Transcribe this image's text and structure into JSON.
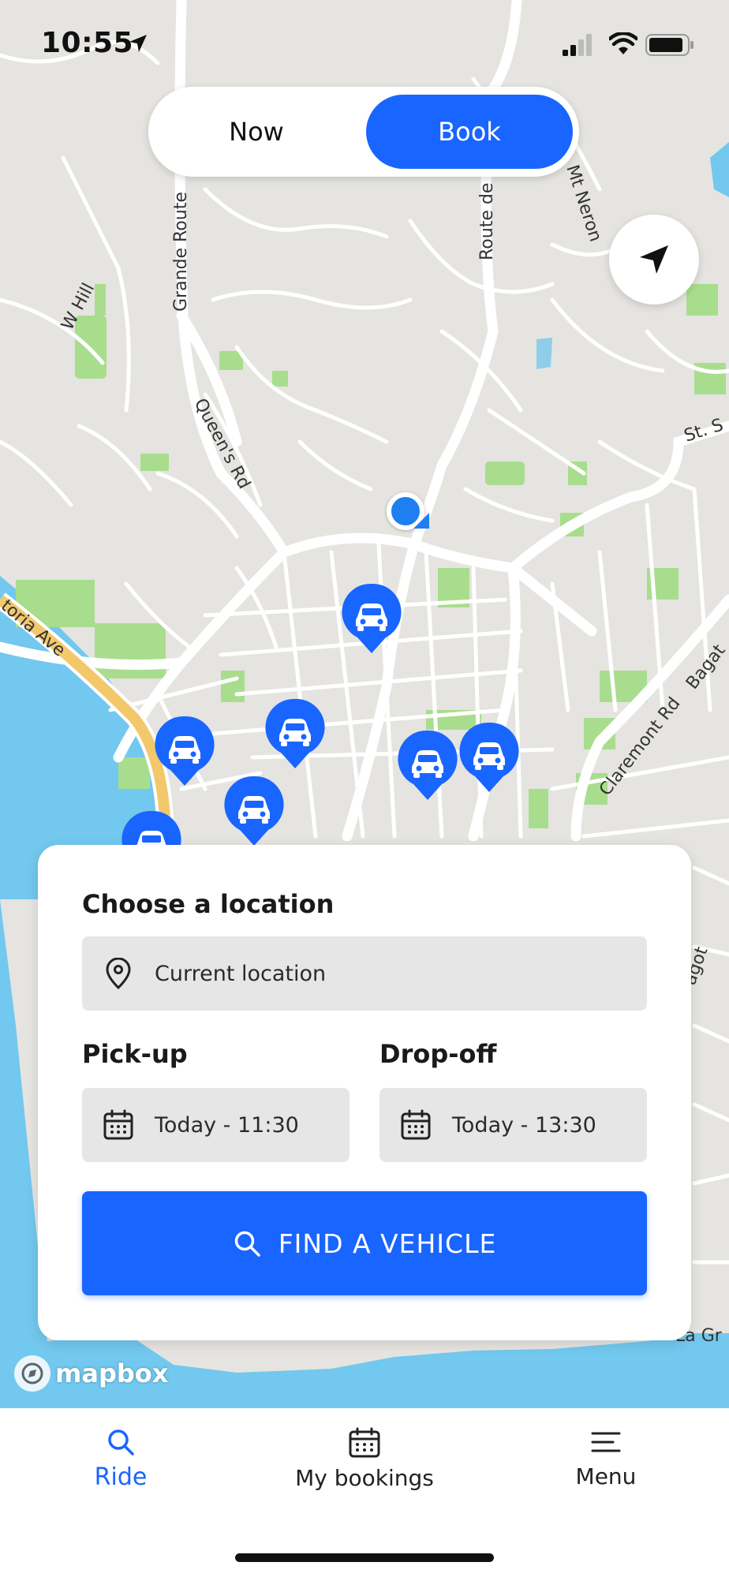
{
  "status_bar": {
    "time": "10:55"
  },
  "mode_toggle": {
    "now_label": "Now",
    "book_label": "Book",
    "selected": "Book"
  },
  "map": {
    "street_labels": [
      "W Hill",
      "Grande Route",
      "Queen's Rd",
      "Route de",
      "Mt Neron",
      "St. S",
      "toria Ave",
      "Claremont Rd",
      "Bagat",
      "agot",
      "La Gr"
    ],
    "vehicle_pin_count": 7,
    "attribution": "mapbox"
  },
  "booking_card": {
    "title": "Choose a location",
    "location_value": "Current location",
    "pickup_label": "Pick-up",
    "pickup_value": "Today - 11:30",
    "dropoff_label": "Drop-off",
    "dropoff_value": "Today - 13:30",
    "find_button": "FIND A VEHICLE"
  },
  "tab_bar": {
    "items": [
      {
        "label": "Ride",
        "icon": "search-icon",
        "active": true
      },
      {
        "label": "My bookings",
        "icon": "calendar-icon",
        "active": false
      },
      {
        "label": "Menu",
        "icon": "menu-icon",
        "active": false
      }
    ]
  },
  "colors": {
    "accent": "#1965ff",
    "map_land": "#e5e4e0",
    "map_water": "#72c8ee",
    "map_park": "#a9dd8e",
    "road_major": "#f2c86b"
  }
}
